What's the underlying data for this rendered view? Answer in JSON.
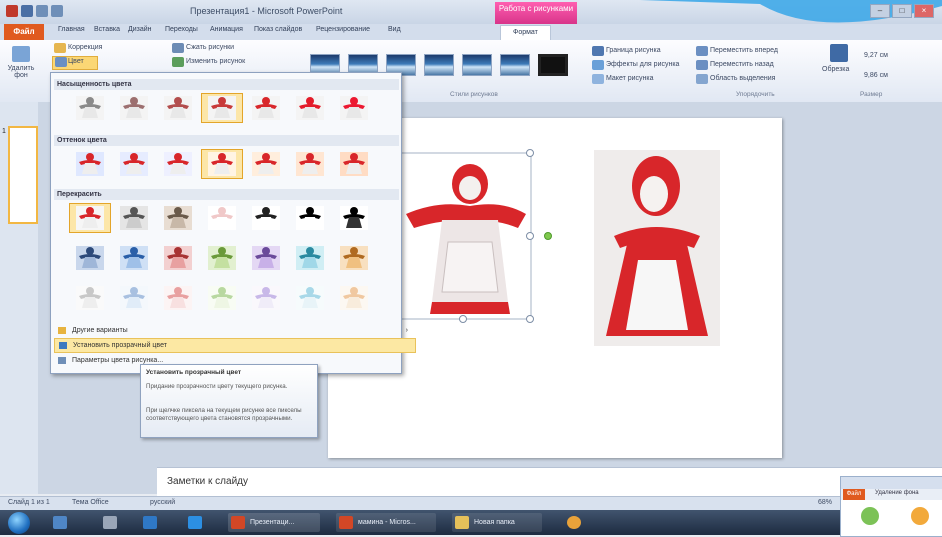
{
  "window": {
    "title": "Презентация1 - Microsoft PowerPoint",
    "context_tab_header": "Работа с рисунками"
  },
  "tabs": [
    {
      "label": "Файл"
    },
    {
      "label": "Главная"
    },
    {
      "label": "Вставка"
    },
    {
      "label": "Дизайн"
    },
    {
      "label": "Переходы"
    },
    {
      "label": "Анимация"
    },
    {
      "label": "Показ слайдов"
    },
    {
      "label": "Рецензирование"
    },
    {
      "label": "Вид"
    },
    {
      "label": "Формат"
    }
  ],
  "ribbon": {
    "remove_bg": "Удалить фон",
    "corrections": "Коррекция",
    "color": "Цвет",
    "compress": "Сжать рисунки",
    "change_picture": "Изменить рисунок",
    "picture_styles_group": "Стили рисунков",
    "picture_border": "Граница рисунка",
    "picture_effects": "Эффекты для рисунка",
    "picture_layout": "Макет рисунка",
    "bring_forward": "Переместить вперед",
    "send_backward": "Переместить назад",
    "selection_pane": "Область выделения",
    "arrange_group": "Упорядочить",
    "crop": "Обрезка",
    "height_value": "9,27 см",
    "width_value": "9,86 см",
    "size_group": "Размер"
  },
  "dropdown": {
    "saturation_header": "Насыщенность цвета",
    "tone_header": "Оттенок цвета",
    "recolor_header": "Перекрасить",
    "more_variations": "Другие варианты",
    "set_transparent": "Установить прозрачный цвет",
    "color_options": "Параметры цвета рисунка..."
  },
  "tooltip": {
    "title": "Установить прозрачный цвет",
    "p1": "Придание прозрачности цвету текущего рисунка.",
    "p2": "При щелчке пиксела на текущем рисунке все пикселы соответствующего цвета становятся прозрачными."
  },
  "slides_panel": {
    "slide_num": "1"
  },
  "notes": {
    "placeholder": "Заметки к слайду"
  },
  "status": {
    "slide_info": "Слайд 1 из 1",
    "theme": "Тема Office",
    "language": "русский",
    "zoom": "68%"
  },
  "taskbar": {
    "app1": "Презентаци...",
    "app2": "мамина - Micros...",
    "app3": "Новая папка"
  },
  "mini_window": {
    "file_tab": "Файл",
    "tab_text": "Удаление фона"
  },
  "colors": {
    "accent": "#e05a1f",
    "context_tab": "#e0408f",
    "doll_red": "#d8262a"
  }
}
